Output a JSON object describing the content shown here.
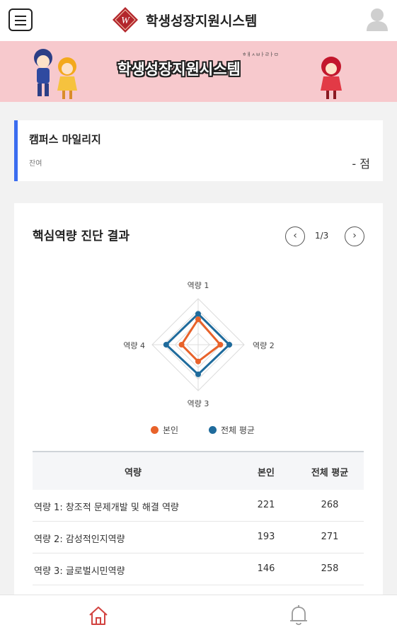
{
  "header": {
    "app_title": "학생성장지원시스템",
    "logo_letter": "W"
  },
  "banner": {
    "title": "학생성장지원시스템",
    "subtitle": "ㅎㅐㅅㅂㅏㄹㅏㅁ"
  },
  "mileage": {
    "title": "캠퍼스 마일리지",
    "balance_label": "잔여",
    "balance_value": "- 점"
  },
  "diagnosis": {
    "title": "핵심역량 진단 결과",
    "page_indicator": "1/3",
    "prev_icon": "chevron-left-icon",
    "next_icon": "chevron-right-icon",
    "legend": [
      {
        "label": "본인",
        "color": "#e8622a"
      },
      {
        "label": "전체 평균",
        "color": "#1f6b9c"
      }
    ],
    "table": {
      "headers": [
        "역량",
        "본인",
        "전체 평균"
      ],
      "rows": [
        {
          "name": "역량 1: 창조적 문제개발 및 해결 역량",
          "self": "221",
          "avg": "268"
        },
        {
          "name": "역량 2: 감성적인지역량",
          "self": "193",
          "avg": "271"
        },
        {
          "name": "역량 3: 글로벌시민역량",
          "self": "146",
          "avg": "258"
        }
      ]
    }
  },
  "chart_data": {
    "type": "radar",
    "categories": [
      "역량 1",
      "역량 2",
      "역량 3",
      "역량 4"
    ],
    "series": [
      {
        "name": "본인",
        "values": [
          221,
          193,
          146,
          144
        ],
        "color": "#e8622a"
      },
      {
        "name": "전체 평균",
        "values": [
          268,
          271,
          258,
          278
        ],
        "color": "#1f6b9c"
      }
    ],
    "range": [
      0,
      400
    ],
    "grid": true,
    "legend": "bottom"
  },
  "bottom_nav": {
    "home_icon": "home-icon",
    "bell_icon": "bell-icon",
    "active_color": "#d2423f"
  }
}
